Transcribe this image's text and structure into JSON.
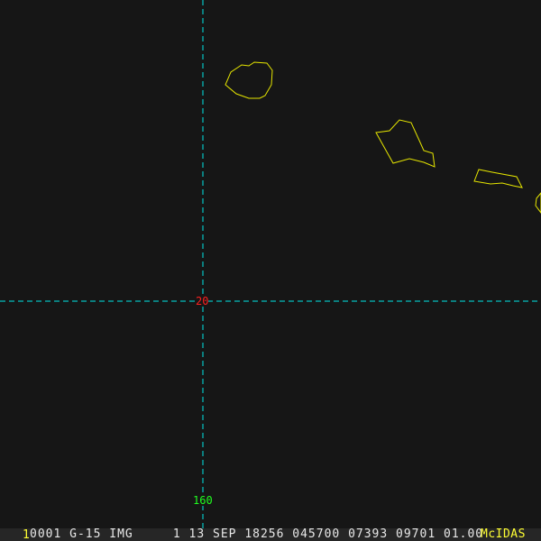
{
  "map": {
    "lat_label": "20",
    "lon_label": "160",
    "grid_color": "#00e5e5",
    "coast_color": "#e6e600",
    "lat_label_color": "#ff2020",
    "lon_label_color": "#20ff20"
  },
  "status_bar": {
    "frame_number": "1",
    "info": "0001 G-15 IMG     1 13 SEP 18256 045700 07393 09701 01.00",
    "brand": "McIDAS"
  }
}
